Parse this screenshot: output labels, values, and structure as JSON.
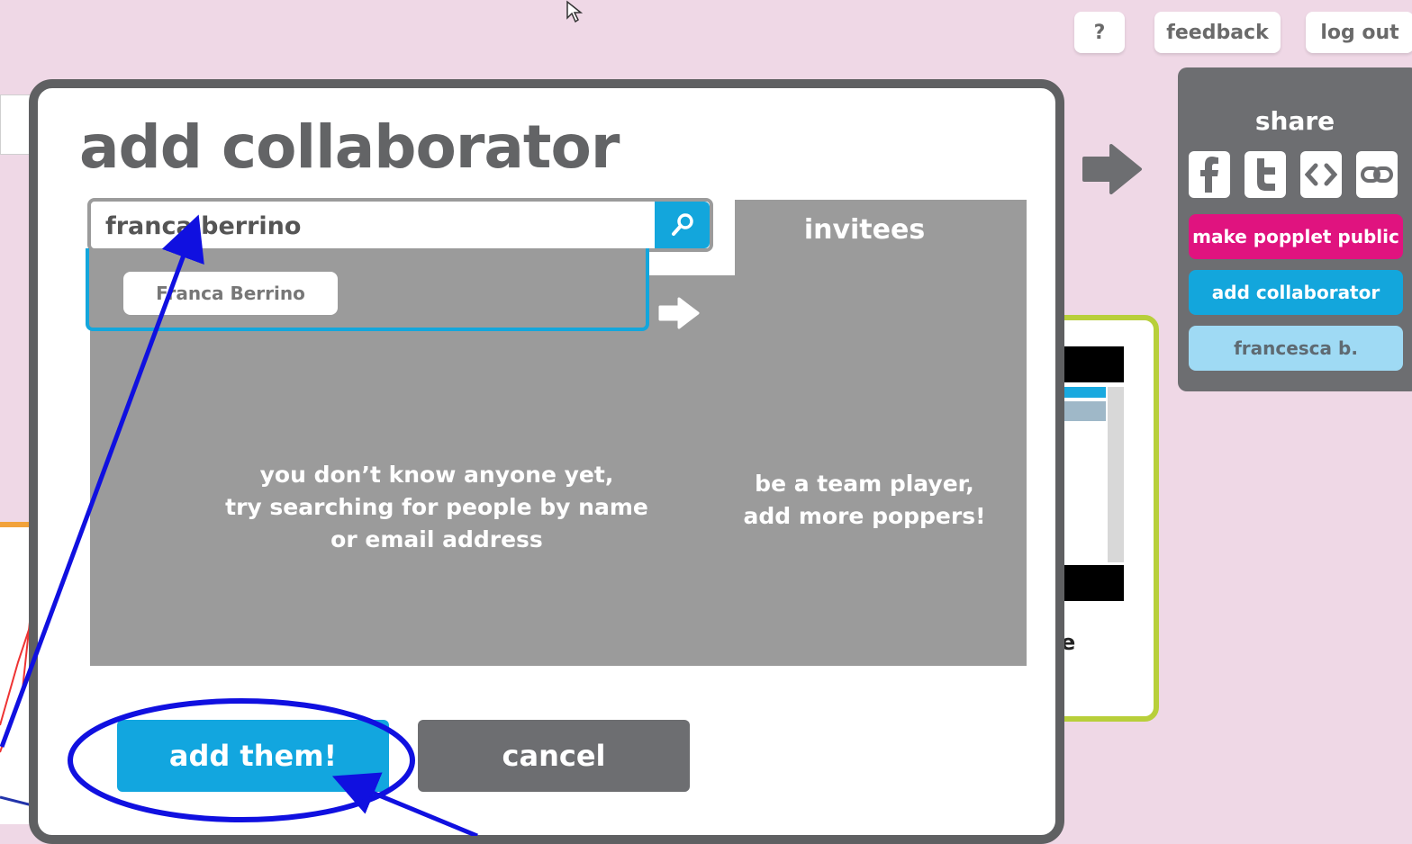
{
  "topbar": {
    "help_label": "?",
    "feedback_label": "feedback",
    "logout_label": "log out"
  },
  "share": {
    "title": "share",
    "icons": [
      "facebook-icon",
      "twitter-icon",
      "embed-icon",
      "link-icon"
    ],
    "make_public_label": "make popplet public",
    "add_collaborator_label": "add collaborator",
    "user_label": "francesca b."
  },
  "modal": {
    "title": "add collaborator",
    "search": {
      "value": "franca berrino",
      "placeholder": ""
    },
    "suggestions": [
      "Franca Berrino"
    ],
    "invitees_title": "invitees",
    "empty_known": "you don’t know anyone yet,\ntry searching for people by name\nor email address",
    "empty_invitees": "be a team player,\nadd more poppers!",
    "add_label": "add them!",
    "cancel_label": "cancel"
  },
  "background": {
    "popple_text": "e"
  },
  "colors": {
    "background": "#efd8e6",
    "accent_blue": "#13a6dc",
    "magenta": "#e0137f",
    "light_blue": "#9fdaf4",
    "panel_gray": "#6d6e71",
    "area_gray": "#9b9b9b",
    "annotation_blue": "#1010e0"
  }
}
